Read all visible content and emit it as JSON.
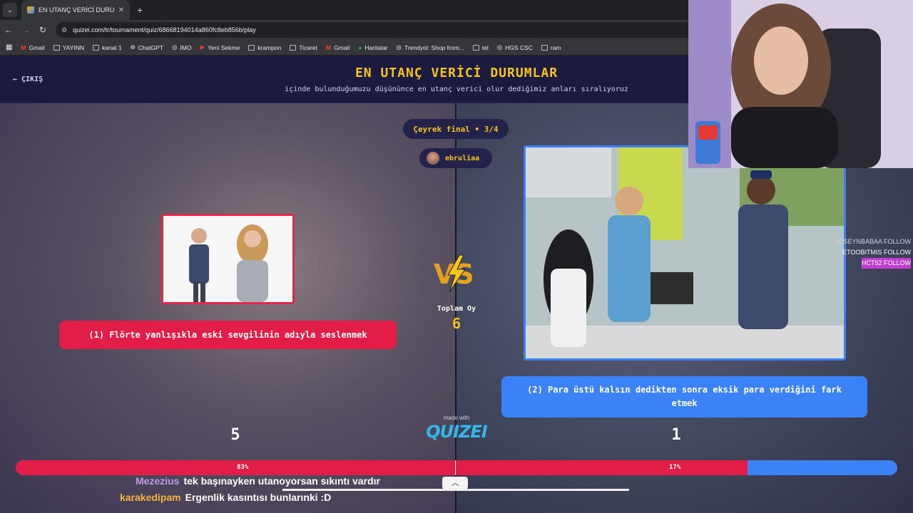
{
  "browser": {
    "tab_title": "EN UTANÇ VERİCİ DURUMLAR",
    "url": "quizei.com/tr/tournament/quiz/68668194014a860fc8eb856b/play",
    "bookmarks": [
      "Gmail",
      "YAYINN",
      "kanal 1",
      "ChatGPT",
      "IMO",
      "Yeni Sekme",
      "krampon",
      "Ticaret",
      "Gmail",
      "Haritalar",
      "Trendyol: Shop from...",
      "tel",
      "HGS CSC",
      "ram"
    ]
  },
  "header": {
    "exit_label": "ÇIKIŞ",
    "title": "EN UTANÇ VERİCİ DURUMLAR",
    "subtitle": "içinde bulunduğumuzu düşününce en utanç verici olur dediğimiz anları sıralıyoruz"
  },
  "round": {
    "label": "Çeyrek final • 3/4",
    "username": "ebruliaa"
  },
  "options": [
    {
      "label": "(1) Flörte yanlışıkla eski sevgilinin adıyla seslenmek",
      "votes": "5",
      "percent": "83%",
      "color": "#e11d48"
    },
    {
      "label": "(2) Para üstü kalsın dedikten sonra eksik para verdiğini fark etmek",
      "votes": "1",
      "percent": "17%",
      "color": "#3b82f6"
    }
  ],
  "total": {
    "label": "Toplam Oy",
    "value": "6"
  },
  "branding": {
    "made_with": "made with",
    "logo": "QUIZEI"
  },
  "progress": {
    "red_fraction": 0.83
  },
  "follows": [
    {
      "name": "HUSEYNBABAA",
      "action": "FOLLOW"
    },
    {
      "name": "ETOOBITMIS",
      "action": "FOLLOW"
    },
    {
      "name": "HCT52",
      "action": "FOLLOW"
    }
  ],
  "chat": [
    {
      "user": "Mezezius",
      "message": "tek başınayken utanoyorsan sıkıntı vardır"
    },
    {
      "user": "karakedipam",
      "message": "Ergenlik kasıntısı bunlarınki :D"
    }
  ]
}
